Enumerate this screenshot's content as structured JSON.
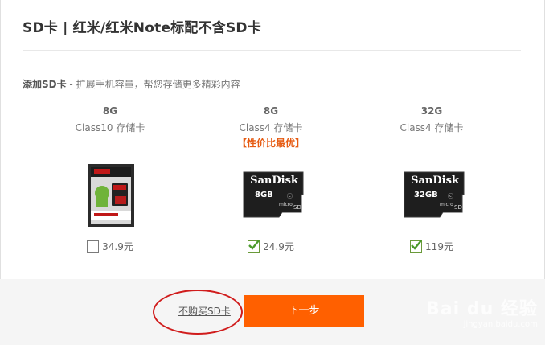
{
  "header": {
    "title": "SD卡 | 红米/红米Note标配不含SD卡"
  },
  "intro": {
    "bold": "添加SD卡",
    "text": " - 扩展手机容量，帮您存储更多精彩内容"
  },
  "products": [
    {
      "size": "8G",
      "class": "Class10 存储卡",
      "badge": "",
      "price": "34.9元",
      "checked": false,
      "card_brand": "",
      "card_label": ""
    },
    {
      "size": "8G",
      "class": "Class4 存储卡",
      "badge": "【性价比最优】",
      "price": "24.9元",
      "checked": true,
      "card_brand": "SanDisk",
      "card_label": "8GB"
    },
    {
      "size": "32G",
      "class": "Class4 存储卡",
      "badge": "",
      "price": "119元",
      "checked": true,
      "card_brand": "SanDisk",
      "card_label": "32GB"
    }
  ],
  "footer": {
    "skip_label": "不购买SD卡",
    "next_label": "下一步"
  },
  "watermark": {
    "main": "Bai du 经验",
    "sub": "jingyan.baidu.com"
  },
  "colors": {
    "accent": "#ff6000",
    "badge": "#e65a11",
    "annotation_circle": "#d01c1c",
    "check": "#4a9a2a"
  }
}
